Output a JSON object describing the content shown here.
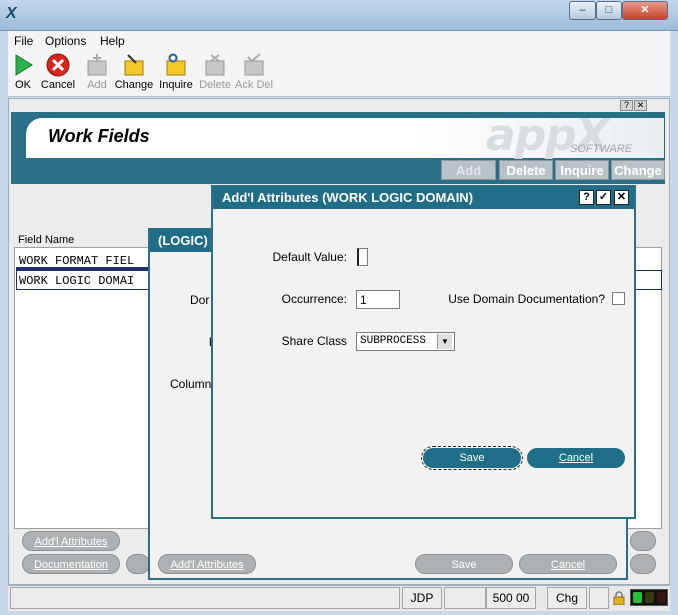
{
  "menu": {
    "file": "File",
    "options": "Options",
    "help": "Help"
  },
  "toolbar": {
    "ok": "OK",
    "cancel": "Cancel",
    "add": "Add",
    "change": "Change",
    "inquire": "Inquire",
    "delete": "Delete",
    "ack_del": "Ack Del"
  },
  "window_controls": {
    "min": "–",
    "max": "□",
    "close": "✕"
  },
  "help_buttons": {
    "help": "?",
    "close": "✕"
  },
  "screen": {
    "title": "Work Fields",
    "brand": "appX",
    "brand_sub": "SOFTWARE",
    "modes": {
      "add": "Add",
      "delete": "Delete",
      "inquire": "Inquire",
      "change": "Change"
    },
    "column_header": "Field Name",
    "rows": [
      "WORK FORMAT FIEL",
      "WORK LOGIC DOMAI"
    ],
    "buttons": {
      "addl_attributes": "Add'l Attributes",
      "documentation": "Documentation"
    }
  },
  "logic_dialog": {
    "title": "(LOGIC)",
    "labels": {
      "dom": "Dor",
      "l": "l",
      "column": "Column"
    },
    "buttons": {
      "addl_attributes": "Add'l Attributes",
      "save": "Save",
      "cancel": "Cancel"
    }
  },
  "attr_dialog": {
    "title": "Add'l Attributes  (WORK LOGIC DOMAIN)",
    "title_buttons": {
      "help": "?",
      "ok": "✓",
      "close": "✕"
    },
    "default_value_label": "Default Value:",
    "default_value": "",
    "occurrence_label": "Occurrence:",
    "occurrence_value": "1",
    "use_domain_doc_label": "Use Domain Documentation?",
    "use_domain_doc_checked": false,
    "share_class_label": "Share Class",
    "share_class_value": "SUBPROCESS",
    "save_label": "Save",
    "cancel_label": "Cancel"
  },
  "status": {
    "user": "JDP",
    "amount": "500 00",
    "mode": "Chg"
  },
  "colors": {
    "accent": "#1f6d87",
    "banner": "#2b6f86",
    "pill": "#aeb1b3"
  }
}
